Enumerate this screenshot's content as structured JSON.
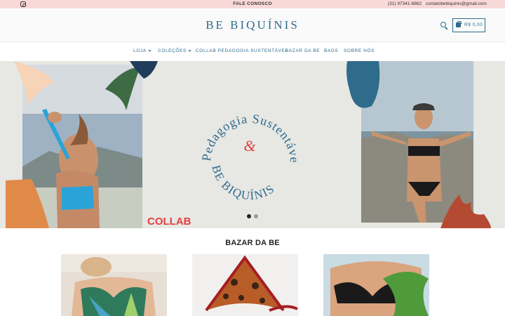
{
  "topbar": {
    "center": "FALE CONOSCO",
    "phone": "(31) 97341-8862",
    "email": "contatobebiquinis@gmail.com",
    "social_icon": "instagram-icon"
  },
  "header": {
    "logo": "BE BIQUÍNIS",
    "search_icon": "search-icon",
    "cart_icon": "shopping-bag-icon",
    "cart_total": "R$ 0,00"
  },
  "nav": {
    "items": [
      {
        "label": "LOJA",
        "dropdown": true
      },
      {
        "label": "COLEÇÕES",
        "dropdown": true
      },
      {
        "label": "COLLAB PEDAGOGIA SUSTENTÁVEL",
        "dropdown": false
      },
      {
        "label": "BAZAR DA BE",
        "dropdown": false
      },
      {
        "label": "BAGS",
        "dropdown": false
      },
      {
        "label": "SOBRE NÓS",
        "dropdown": false
      }
    ]
  },
  "hero": {
    "arc_top": "Pedagogia Sustentável",
    "ampersand": "&",
    "arc_bottom": "BE BIQUÍNIS",
    "collab_label": "COLLAB",
    "slide_count": 2,
    "active_slide": 1
  },
  "colors": {
    "accent": "#2e6b8e",
    "topbar_bg": "#f9d9d8",
    "collab_red": "#e0413f",
    "hero_bg": "#e7e7e3"
  },
  "section": {
    "title": "BAZAR DA BE"
  },
  "products": [
    {
      "name": "product-1"
    },
    {
      "name": "product-2"
    },
    {
      "name": "product-3"
    }
  ]
}
